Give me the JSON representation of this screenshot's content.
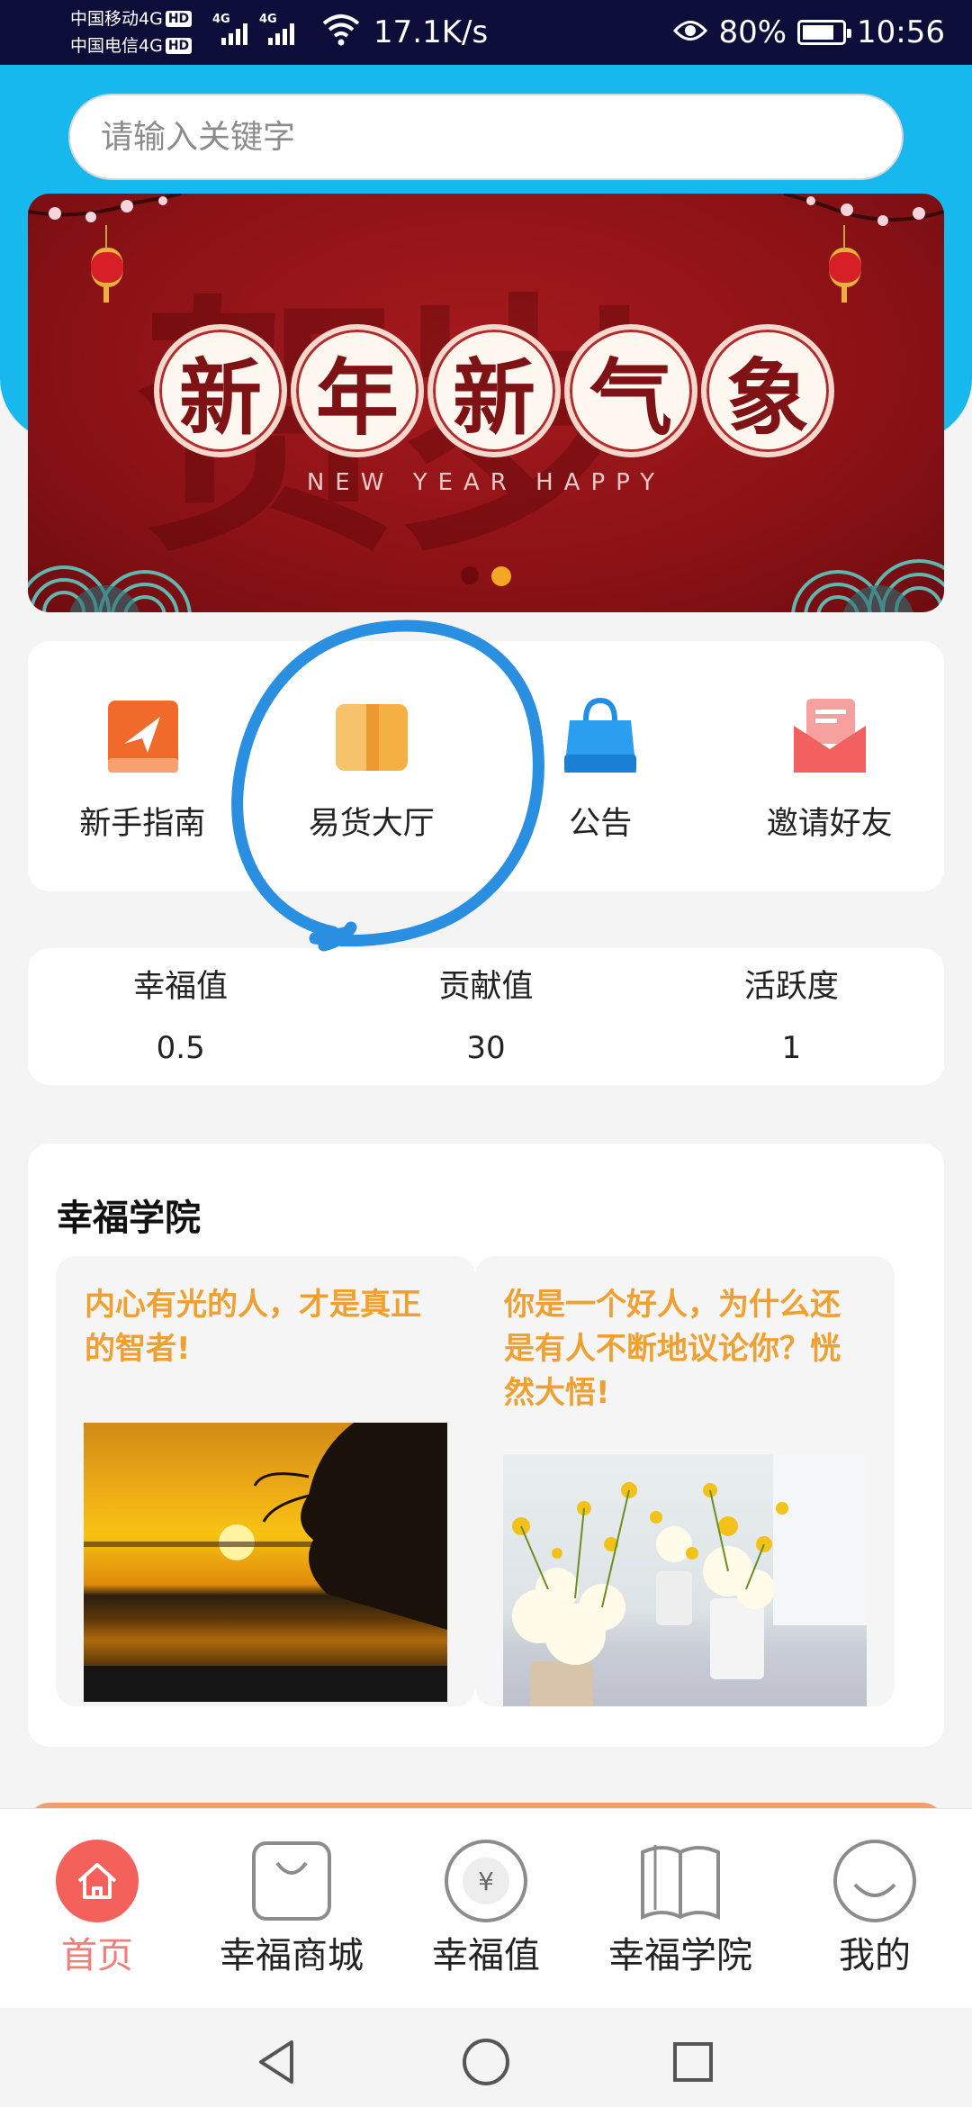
{
  "status_bar": {
    "carrier_1": "中国移动4G",
    "carrier_2": "中国电信4G",
    "hd_badge": "HD",
    "network_1": "4G",
    "network_2": "4G",
    "speed": "17.1K/s",
    "battery": "80%",
    "time": "10:56"
  },
  "search": {
    "placeholder": "请输入关键字"
  },
  "banner": {
    "chars": [
      "新",
      "年",
      "新",
      "气",
      "象"
    ],
    "subtitle": "NEW YEAR HAPPY",
    "slides": 2,
    "active_slide": 2
  },
  "quick_menu": [
    {
      "label": "新手指南",
      "icon": "guide-icon"
    },
    {
      "label": "易货大厅",
      "icon": "book-icon"
    },
    {
      "label": "公告",
      "icon": "shopping-bag-icon"
    },
    {
      "label": "邀请好友",
      "icon": "envelope-icon"
    }
  ],
  "stats": [
    {
      "label": "幸福值",
      "value": "0.5"
    },
    {
      "label": "贡献值",
      "value": "30"
    },
    {
      "label": "活跃度",
      "value": "1"
    }
  ],
  "academy": {
    "title": "幸福学院",
    "cards": [
      {
        "title": "内心有光的人，才是真正的智者!"
      },
      {
        "title": "你是一个好人，为什么还是有人不断地议论你？恍然大悟!"
      }
    ]
  },
  "bottom_nav": [
    {
      "label": "首页",
      "icon": "home-icon",
      "active": true
    },
    {
      "label": "幸福商城",
      "icon": "bag-icon",
      "active": false
    },
    {
      "label": "幸福值",
      "icon": "yen-coin-icon",
      "active": false
    },
    {
      "label": "幸福学院",
      "icon": "open-book-icon",
      "active": false
    },
    {
      "label": "我的",
      "icon": "smile-icon",
      "active": false
    }
  ],
  "colors": {
    "header": "#16b8ee",
    "accent_orange": "#f0a030",
    "nav_active": "#f27d7a",
    "annotation": "#2a8fe0"
  }
}
